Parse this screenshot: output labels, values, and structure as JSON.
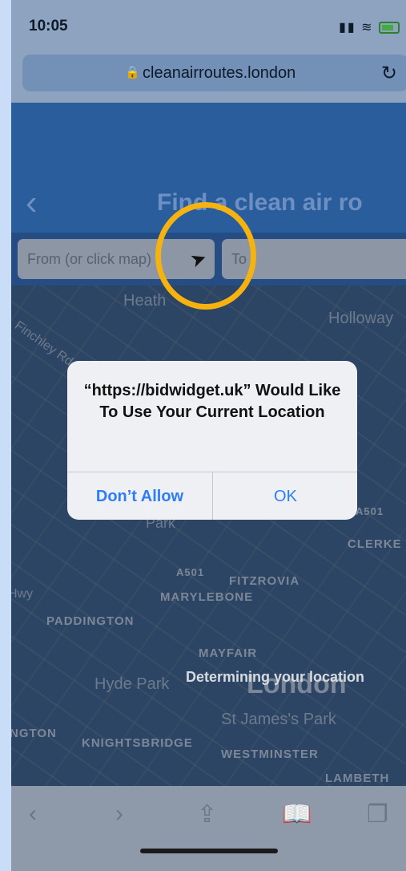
{
  "status": {
    "time": "10:05"
  },
  "browser": {
    "url": "cleanairroutes.london"
  },
  "app": {
    "title": "Find a clean air ro",
    "from_placeholder": "From (or click map)",
    "to_placeholder": "To"
  },
  "map": {
    "labels": [
      "Heath",
      "Holloway",
      "Finchley Rd",
      "A501",
      "CLERKE",
      "A501",
      "FITZROVIA",
      "MARYLEBONE",
      "PADDINGTON",
      "Hwy",
      "MAYFAIR",
      "Hyde Park",
      "London",
      "St James's Park",
      "NGTON",
      "KNIGHTSBRIDGE",
      "WESTMINSTER",
      "LAMBETH",
      "Park"
    ],
    "status_text": "Determining your location"
  },
  "dialog": {
    "message": "“https://bidwidget.uk” Would Like To Use Your Current Location",
    "deny_label": "Don’t Allow",
    "ok_label": "OK"
  },
  "toolbar": {
    "back_icon": "chevron-left-icon",
    "forward_icon": "chevron-right-icon",
    "share_icon": "share-icon",
    "bookmarks_icon": "bookmarks-icon",
    "tabs_icon": "tabs-icon"
  },
  "colors": {
    "accent": "#2d7df6",
    "highlight": "#f6b20f",
    "header": "#2a5d9c"
  }
}
